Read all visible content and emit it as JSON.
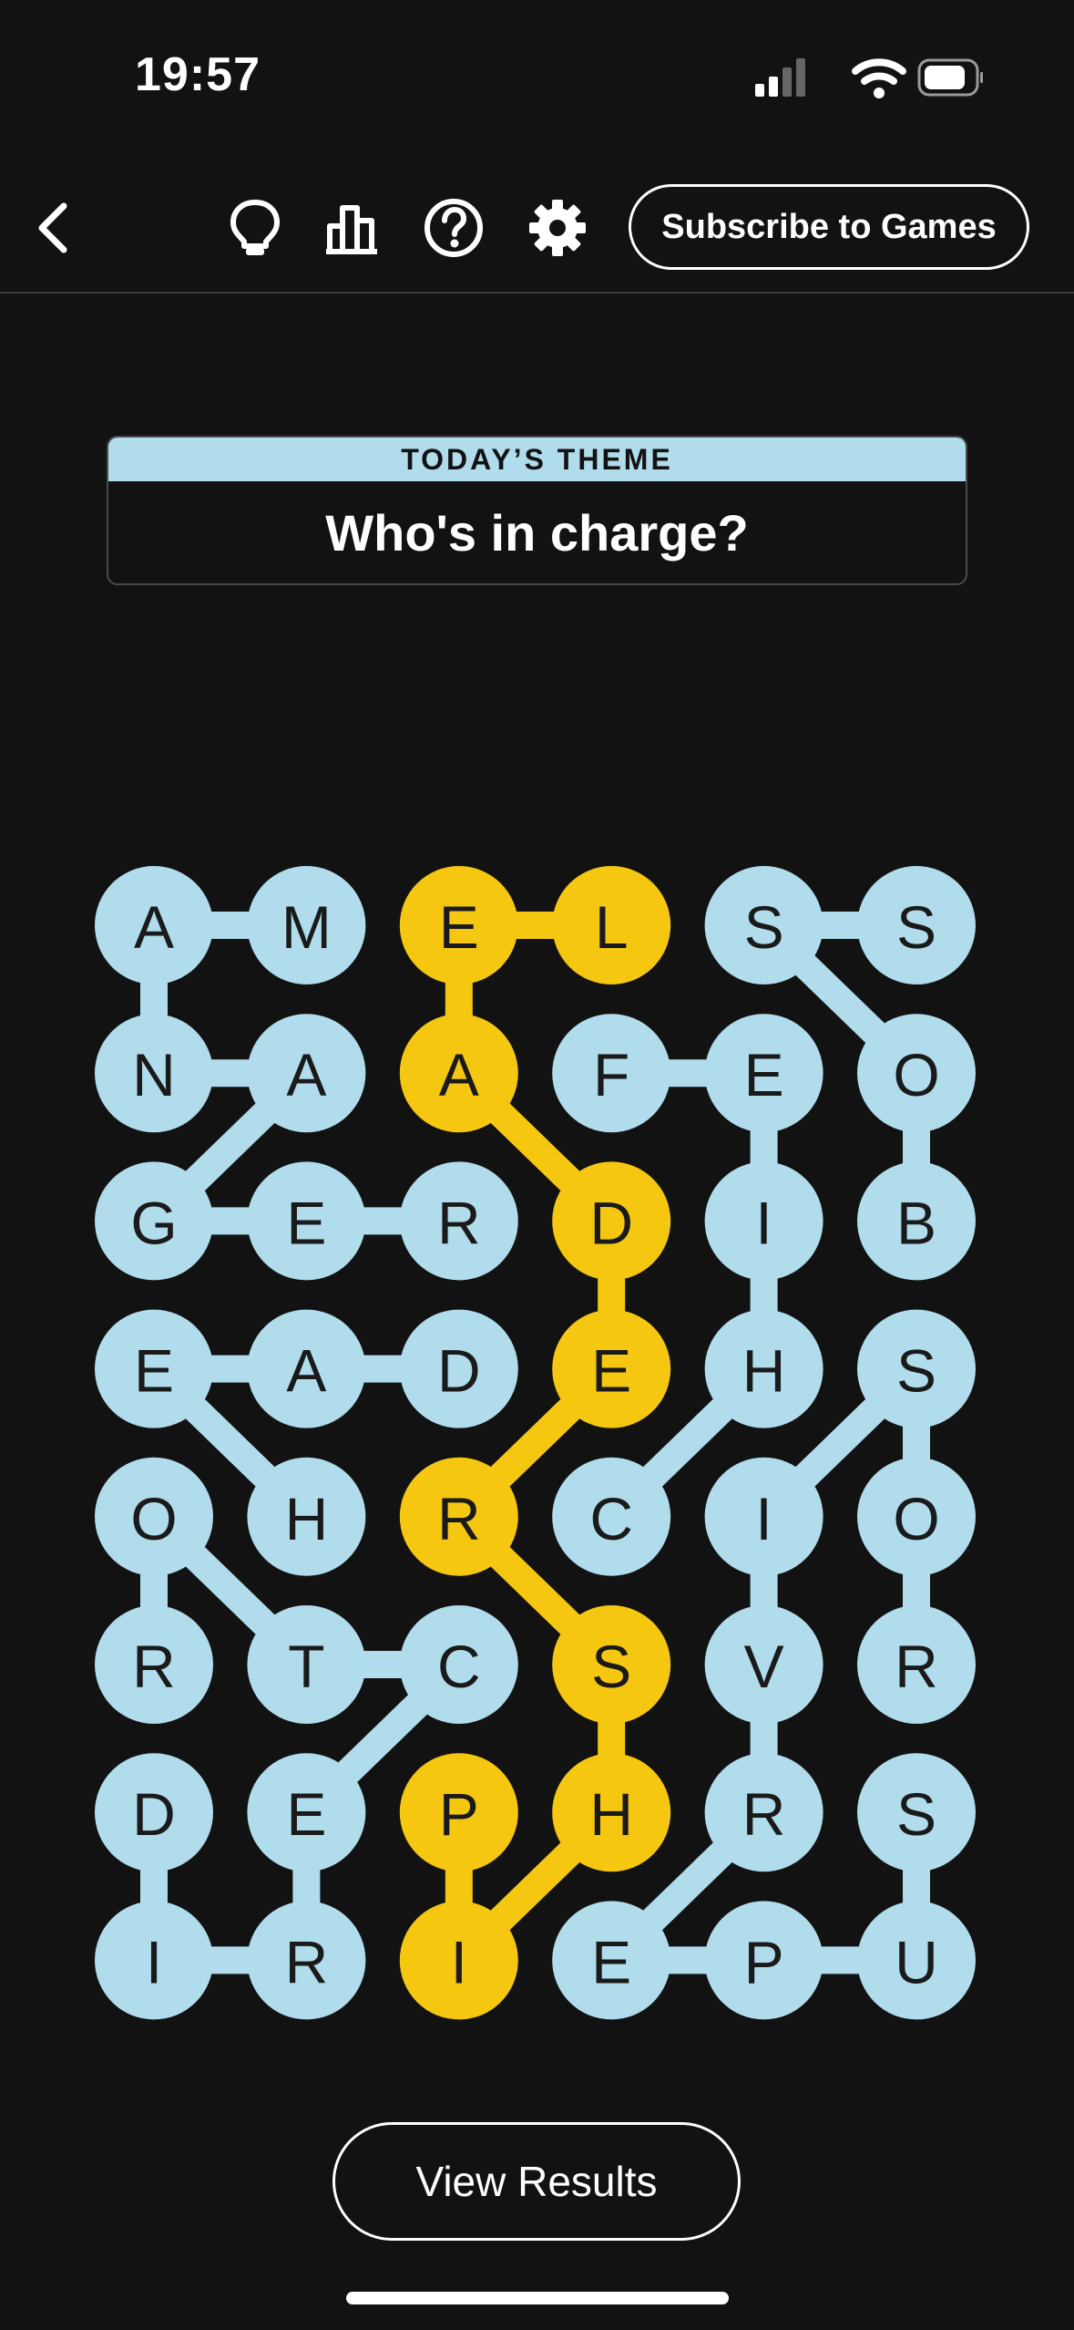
{
  "status_bar": {
    "time": "19:57",
    "icons": [
      "cellular-signal-icon",
      "wifi-icon",
      "battery-icon"
    ]
  },
  "toolbar": {
    "icons": [
      "back-chevron-icon",
      "hint-lightbulb-icon",
      "stats-chart-icon",
      "help-question-icon",
      "settings-gear-icon"
    ],
    "subscribe_label": "Subscribe to Games"
  },
  "theme": {
    "header": "TODAY’S THEME",
    "title": "Who's in charge?"
  },
  "board": {
    "colors": {
      "found": "#b0dcec",
      "spangram": "#f5c710",
      "text": "#1a1a1a"
    },
    "rows": [
      [
        "A",
        "M",
        "E",
        "L",
        "S",
        "S"
      ],
      [
        "N",
        "A",
        "A",
        "F",
        "E",
        "O"
      ],
      [
        "G",
        "E",
        "R",
        "D",
        "I",
        "B"
      ],
      [
        "E",
        "A",
        "D",
        "E",
        "H",
        "S"
      ],
      [
        "O",
        "H",
        "R",
        "C",
        "I",
        "O"
      ],
      [
        "R",
        "T",
        "C",
        "S",
        "V",
        "R"
      ],
      [
        "D",
        "E",
        "P",
        "H",
        "R",
        "S"
      ],
      [
        "I",
        "R",
        "I",
        "E",
        "P",
        "U"
      ]
    ],
    "words": [
      {
        "word": "MANAGER",
        "kind": "found",
        "path": [
          [
            0,
            1
          ],
          [
            0,
            0
          ],
          [
            1,
            0
          ],
          [
            1,
            1
          ],
          [
            2,
            0
          ],
          [
            2,
            1
          ],
          [
            2,
            2
          ]
        ]
      },
      {
        "word": "HEAD",
        "kind": "found",
        "path": [
          [
            4,
            1
          ],
          [
            3,
            0
          ],
          [
            3,
            1
          ],
          [
            3,
            2
          ]
        ]
      },
      {
        "word": "DIRECTOR",
        "kind": "found",
        "path": [
          [
            6,
            0
          ],
          [
            7,
            0
          ],
          [
            7,
            1
          ],
          [
            6,
            1
          ],
          [
            5,
            2
          ],
          [
            5,
            1
          ],
          [
            4,
            0
          ],
          [
            5,
            0
          ]
        ]
      },
      {
        "word": "CHIEF",
        "kind": "found",
        "path": [
          [
            4,
            3
          ],
          [
            3,
            4
          ],
          [
            2,
            4
          ],
          [
            1,
            4
          ],
          [
            1,
            3
          ]
        ]
      },
      {
        "word": "SUPERVISOR",
        "kind": "found",
        "path": [
          [
            6,
            5
          ],
          [
            7,
            5
          ],
          [
            7,
            4
          ],
          [
            7,
            3
          ],
          [
            6,
            4
          ],
          [
            5,
            4
          ],
          [
            4,
            4
          ],
          [
            3,
            5
          ],
          [
            4,
            5
          ],
          [
            5,
            5
          ]
        ]
      },
      {
        "word": "BOSS",
        "kind": "found",
        "path": [
          [
            2,
            5
          ],
          [
            1,
            5
          ],
          [
            0,
            4
          ],
          [
            0,
            5
          ]
        ]
      },
      {
        "word": "LEADERSHIP",
        "kind": "spangram",
        "path": [
          [
            0,
            3
          ],
          [
            0,
            2
          ],
          [
            1,
            2
          ],
          [
            2,
            3
          ],
          [
            3,
            3
          ],
          [
            4,
            2
          ],
          [
            5,
            3
          ],
          [
            6,
            3
          ],
          [
            7,
            2
          ],
          [
            6,
            2
          ]
        ]
      }
    ]
  },
  "view_results_label": "View Results"
}
